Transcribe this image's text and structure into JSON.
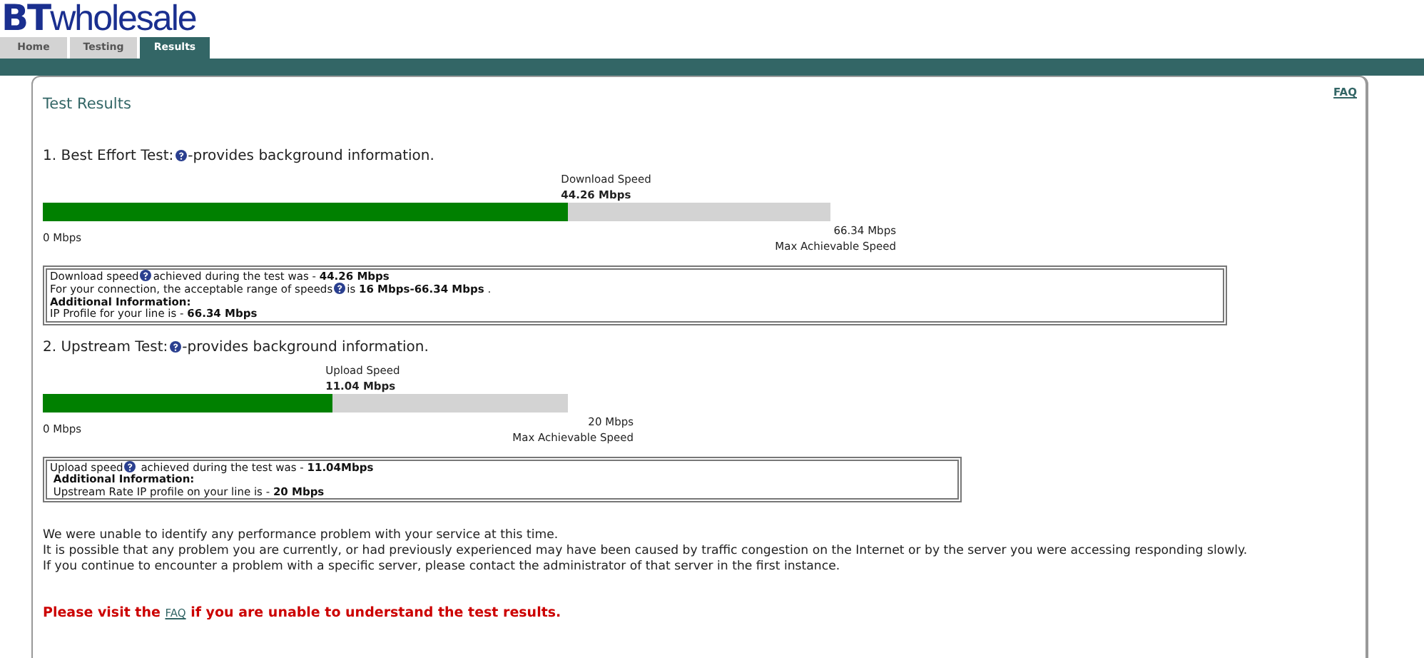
{
  "logo": {
    "brand": "BT",
    "name": "wholesale"
  },
  "tabs": [
    {
      "label": "Home",
      "selected": false
    },
    {
      "label": "Testing",
      "selected": false
    },
    {
      "label": "Results",
      "selected": true
    }
  ],
  "panel": {
    "title": "Test Results",
    "faq_link": "FAQ"
  },
  "tests": [
    {
      "heading": [
        "1. Best Effort Test:",
        "-provides background information."
      ],
      "speed_label": "Download Speed",
      "speed": "44.26 Mbps",
      "level": 0.667,
      "min": "0 Mbps",
      "max": "66.34 Mbps",
      "max_label": "Max Achievable Speed",
      "info": [
        {
          "segments": [
            "Download speed",
            "achieved during the test was - **44.26 Mbps**"
          ]
        },
        {
          "segments": [
            "For your connection, the acceptable range of speeds",
            "is **16 Mbps-66.34 Mbps** ."
          ]
        },
        {
          "segments": [
            "**Additional Information:**"
          ]
        },
        {
          "segments": [
            "IP Profile for your line is - **66.34 Mbps**"
          ]
        }
      ]
    },
    {
      "heading": [
        "2. Upstream Test:",
        "-provides background information."
      ],
      "speed_label": "Upload Speed",
      "speed": "11.04 Mbps",
      "level": 0.552,
      "min": "0 Mbps",
      "max": "20 Mbps",
      "max_label": "Max Achievable Speed",
      "info": [
        {
          "segments": [
            "Upload speed",
            " achieved during the test was - **11.04Mbps**"
          ]
        },
        {
          "segments": [
            " **Additional Information:**"
          ]
        },
        {
          "segments": [
            " Upstream Rate IP profile on your line is - **20 Mbps**"
          ]
        }
      ]
    }
  ],
  "summary": [
    "We were unable to identify any performance problem with your service at this time.",
    "It is possible that any problem you are currently, or had previously experienced may have been caused by traffic congestion on the Internet or by the server you were accessing responding slowly.",
    "If you continue to encounter a problem with a specific server, please contact the administrator of that server in the first instance."
  ],
  "footer": {
    "before": "Please visit the",
    "link": "FAQ",
    "after": "if you are unable to understand the test results."
  }
}
